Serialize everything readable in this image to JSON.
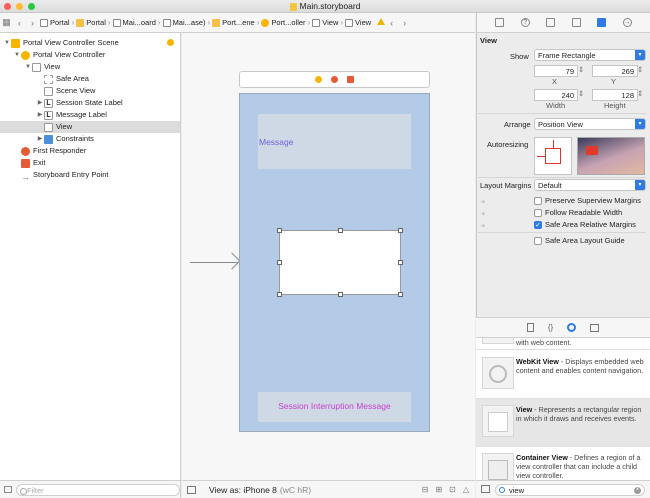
{
  "window": {
    "title": "Main.storyboard"
  },
  "jumpbar": {
    "crumbs": [
      "Portal",
      "Portal",
      "Mai...oard",
      "Mai...ase)",
      "Port...ene",
      "Port...oller",
      "View",
      "View"
    ]
  },
  "outline": {
    "items": [
      {
        "label": "Portal View Controller Scene"
      },
      {
        "label": "Portal View Controller"
      },
      {
        "label": "View"
      },
      {
        "label": "Safe Area"
      },
      {
        "label": "Scene View"
      },
      {
        "label": "Session State Label"
      },
      {
        "label": "Message Label"
      },
      {
        "label": "View"
      },
      {
        "label": "Constraints"
      },
      {
        "label": "First Responder"
      },
      {
        "label": "Exit"
      },
      {
        "label": "Storyboard Entry Point"
      }
    ],
    "filter_placeholder": "Filter"
  },
  "canvas": {
    "message_label": "Message",
    "session_label": "Session Interruption Message",
    "view_as": "View as: iPhone 8",
    "view_as_shortcut": "(wC hR)"
  },
  "inspector": {
    "section": "View",
    "show_label": "Show",
    "show_value": "Frame Rectangle",
    "x_value": "79",
    "y_value": "269",
    "x_label": "X",
    "y_label": "Y",
    "width_value": "240",
    "height_value": "128",
    "width_label": "Width",
    "height_label": "Height",
    "arrange_label": "Arrange",
    "arrange_value": "Position View",
    "autoresizing_label": "Autoresizing",
    "layout_margins_label": "Layout Margins",
    "layout_margins_value": "Default",
    "checkboxes": [
      {
        "label": "Preserve Superview Margins",
        "checked": false
      },
      {
        "label": "Follow Readable Width",
        "checked": false
      },
      {
        "label": "Safe Area Relative Margins",
        "checked": true
      },
      {
        "label": "Safe Area Layout Guide",
        "checked": false
      }
    ]
  },
  "library": {
    "partial": "with web content.",
    "items": [
      {
        "title": "WebKit View",
        "desc": " - Displays embedded web content and enables content navigation."
      },
      {
        "title": "View",
        "desc": " - Represents a rectangular region in which it draws and receives events."
      },
      {
        "title": "Container View",
        "desc": " - Defines a region of a view controller that can include a child view controller."
      }
    ],
    "search_value": "view"
  },
  "colors": {
    "accent": "#2f7ae5",
    "scene_view": "#b3cbe6",
    "message_text": "#7060d8",
    "session_text": "#c83fc8"
  }
}
